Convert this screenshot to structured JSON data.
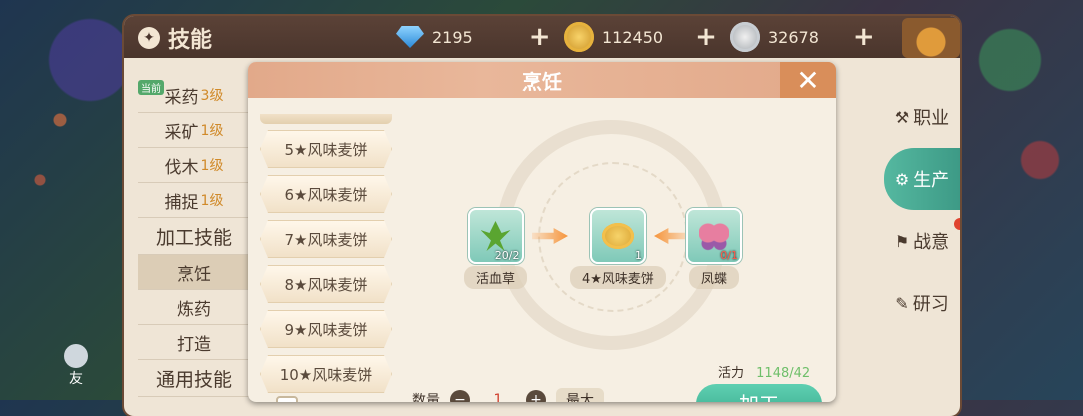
{
  "window": {
    "title": "技能"
  },
  "currencies": [
    {
      "icon": "diamond-icon",
      "value": "2195"
    },
    {
      "icon": "gold-coin-icon",
      "value": "112450"
    },
    {
      "icon": "silver-coin-icon",
      "value": "32678"
    }
  ],
  "plus_label": "+",
  "left_list": {
    "current_tag": "当前",
    "items": [
      {
        "label": "采药",
        "level": "3级"
      },
      {
        "label": "采矿",
        "level": "1级"
      },
      {
        "label": "伐木",
        "level": "1级"
      },
      {
        "label": "捕捉",
        "level": "1级"
      }
    ],
    "section_processing": "加工技能",
    "processing_items": [
      "烹饪",
      "炼药",
      "打造"
    ],
    "section_general": "通用技能"
  },
  "right_nav": [
    {
      "label": "职业",
      "icon": "briefcase-icon"
    },
    {
      "label": "生产",
      "icon": "gear-icon"
    },
    {
      "label": "战意",
      "icon": "flag-icon"
    },
    {
      "label": "研习",
      "icon": "book-icon"
    }
  ],
  "friend_label": "友",
  "dialog": {
    "title": "烹饪",
    "close_label": "✕",
    "recipes": [
      "5★风味麦饼",
      "6★风味麦饼",
      "7★风味麦饼",
      "8★风味麦饼",
      "9★风味麦饼",
      "10★风味麦饼"
    ],
    "materials": {
      "left": {
        "label": "活血草",
        "count": "20/2",
        "icon": "herb-icon"
      },
      "center": {
        "label": "4★风味麦饼",
        "count": "1",
        "icon": "pancake-icon"
      },
      "right": {
        "label": "凤蝶",
        "count": "0/1",
        "icon": "butterfly-icon"
      }
    },
    "vitality_label": "活力",
    "vitality_value": "1148/42",
    "quantity_label": "数量",
    "quantity_value": "1",
    "minus_label": "−",
    "plus_label": "+",
    "max_label": "最大",
    "process_button": "加工"
  },
  "colors": {
    "accent": "#3d9a86",
    "header": "#e2a98a",
    "warning": "#d0402f"
  }
}
